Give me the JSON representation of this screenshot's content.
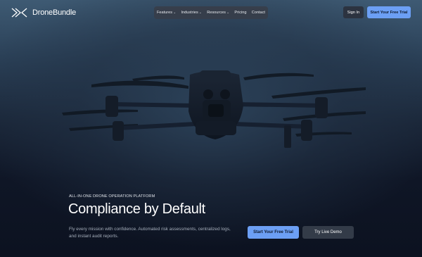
{
  "brand": {
    "name": "DroneBundle",
    "logo_icon": "x-chevrons-logo"
  },
  "nav": {
    "items": [
      {
        "label": "Features",
        "dropdown": true
      },
      {
        "label": "Industries",
        "dropdown": true
      },
      {
        "label": "Resources",
        "dropdown": true
      },
      {
        "label": "Pricing",
        "dropdown": false
      },
      {
        "label": "Contact",
        "dropdown": false
      }
    ],
    "chevron_glyph": "⌄"
  },
  "header": {
    "signin_label": "Sign In",
    "trial_label": "Start Your Free Trial"
  },
  "hero": {
    "eyebrow": "ALL-IN-ONE DRONE OPERATION PLATFORM",
    "title": "Compliance by Default",
    "subtitle": "Fly every mission with confidence. Automated risk assessments, centralized logs, and instant audit reports.",
    "primary_cta": "Start Your Free Trial",
    "secondary_cta": "Try Live Demo",
    "background_image": "drone-in-flight"
  },
  "colors": {
    "accent": "#6c9ff4",
    "background": "#0d1422",
    "nav_bg": "#373e4a",
    "secondary_button": "#333b48"
  }
}
